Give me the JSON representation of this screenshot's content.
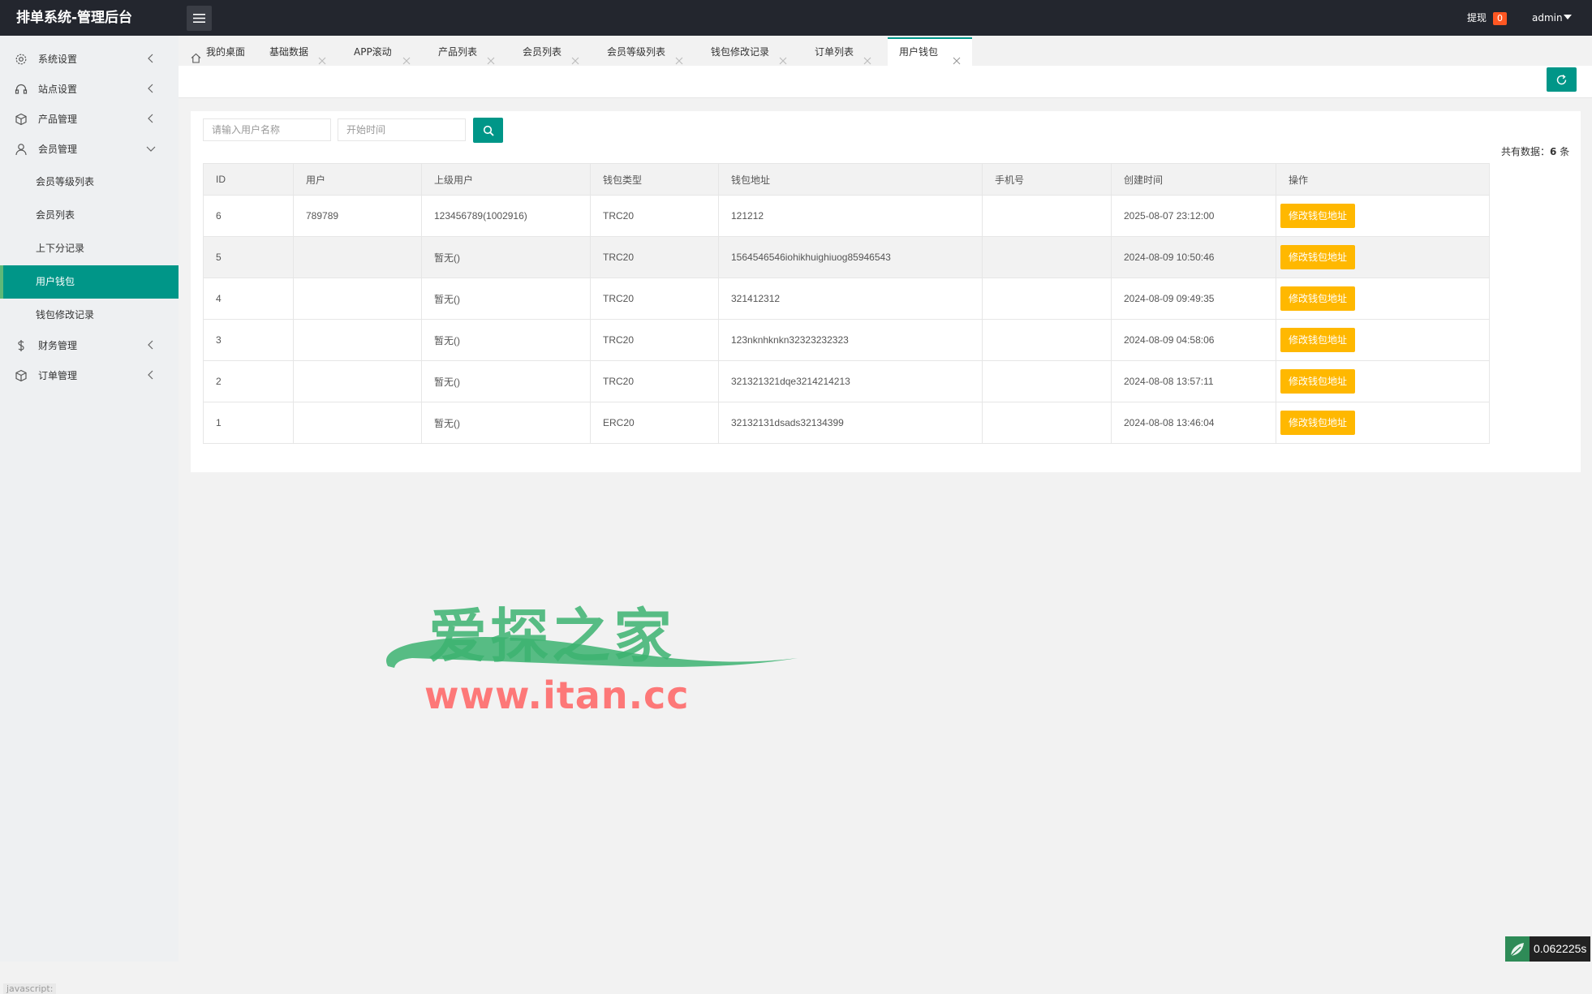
{
  "header": {
    "brand": "排单系统-管理后台",
    "withdraw_label": "提现",
    "withdraw_count": "0",
    "user": "admin"
  },
  "sidebar": {
    "items": [
      {
        "label": "系统设置",
        "icon": "gear-icon"
      },
      {
        "label": "站点设置",
        "icon": "headset-icon"
      },
      {
        "label": "产品管理",
        "icon": "cube-icon"
      },
      {
        "label": "会员管理",
        "icon": "user-icon",
        "expanded": true
      },
      {
        "label": "财务管理",
        "icon": "dollar-icon"
      },
      {
        "label": "订单管理",
        "icon": "cube-icon"
      }
    ],
    "sub_items": [
      {
        "label": "会员等级列表"
      },
      {
        "label": "会员列表"
      },
      {
        "label": "上下分记录"
      },
      {
        "label": "用户钱包",
        "active": true
      },
      {
        "label": "钱包修改记录"
      }
    ]
  },
  "tabs": [
    {
      "label": "我的桌面"
    },
    {
      "label": "基础数据"
    },
    {
      "label": "APP滚动"
    },
    {
      "label": "产品列表"
    },
    {
      "label": "会员列表"
    },
    {
      "label": "会员等级列表"
    },
    {
      "label": "钱包修改记录"
    },
    {
      "label": "订单列表"
    },
    {
      "label": "用户钱包",
      "active": true
    }
  ],
  "search": {
    "username_placeholder": "请输入用户名称",
    "start_time_placeholder": "开始时间"
  },
  "total": {
    "prefix": "共有数据：",
    "count": "6",
    "suffix": "条"
  },
  "table": {
    "columns": [
      "ID",
      "用户",
      "上级用户",
      "钱包类型",
      "钱包地址",
      "手机号",
      "创建时间",
      "操作"
    ],
    "action_label": "修改钱包地址",
    "rows": [
      {
        "id": "6",
        "user": "789789",
        "parent": "123456789(1002916)",
        "type": "TRC20",
        "address": "121212",
        "phone": "",
        "created": "2025-08-07 23:12:00"
      },
      {
        "id": "5",
        "user": "",
        "parent": "暂无()",
        "type": "TRC20",
        "address": "1564546546iohikhuighiuog85946543",
        "phone": "",
        "created": "2024-08-09 10:50:46"
      },
      {
        "id": "4",
        "user": "",
        "parent": "暂无()",
        "type": "TRC20",
        "address": "321412312",
        "phone": "",
        "created": "2024-08-09 09:49:35"
      },
      {
        "id": "3",
        "user": "",
        "parent": "暂无()",
        "type": "TRC20",
        "address": "123nknhknkn32323232323",
        "phone": "",
        "created": "2024-08-09 04:58:06"
      },
      {
        "id": "2",
        "user": "",
        "parent": "暂无()",
        "type": "TRC20",
        "address": "321321321dqe3214214213",
        "phone": "",
        "created": "2024-08-08 13:57:11"
      },
      {
        "id": "1",
        "user": "",
        "parent": "暂无()",
        "type": "ERC20",
        "address": "32132131dsads32134399",
        "phone": "",
        "created": "2024-08-08 13:46:04"
      }
    ]
  },
  "watermark": {
    "title": "爱探之家",
    "url": "www.itan.cc"
  },
  "status_bar": {
    "js_status": "javascript:",
    "timer": "0.062225s"
  },
  "colors": {
    "header_bg": "#23262e",
    "accent": "#009688",
    "action": "#ffb800",
    "badge": "#ff5722"
  }
}
